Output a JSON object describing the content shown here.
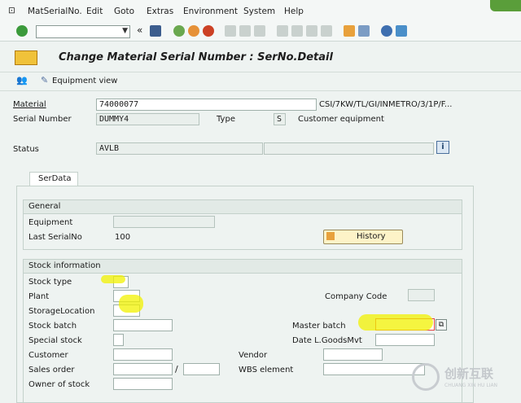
{
  "menu": {
    "items": [
      "MatSerialNo.",
      "Edit",
      "Goto",
      "Extras",
      "Environment",
      "System",
      "Help"
    ]
  },
  "toolbar": {
    "command_value": "",
    "back_symbol": "«"
  },
  "header": {
    "title": "Change Material Serial Number : SerNo.Detail"
  },
  "appbar": {
    "equipment_view": "Equipment view"
  },
  "form": {
    "material_label": "Material",
    "material_value": "74000077",
    "material_desc": "CSI/7KW/TL/GI/INMETRO/3/1P/F...",
    "serial_label": "Serial Number",
    "serial_value": "DUMMY4",
    "type_label": "Type",
    "type_value": "S",
    "type_desc": "Customer equipment",
    "status_label": "Status",
    "status_value": "AVLB",
    "status_value2": ""
  },
  "tabs": [
    {
      "label": "SerData"
    }
  ],
  "general": {
    "heading": "General",
    "equipment_label": "Equipment",
    "equipment_value": "",
    "last_serial_label": "Last SerialNo",
    "last_serial_value": "100",
    "history_button": "History"
  },
  "stock": {
    "heading": "Stock information",
    "stock_type_label": "Stock type",
    "plant_label": "Plant",
    "storage_location_label": "StorageLocation",
    "stock_batch_label": "Stock batch",
    "special_stock_label": "Special stock",
    "customer_label": "Customer",
    "sales_order_label": "Sales order",
    "sales_order_sep": "/",
    "owner_label": "Owner of stock",
    "company_code_label": "Company Code",
    "master_batch_label": "Master batch",
    "date_goods_label": "Date L.GoodsMvt",
    "vendor_label": "Vendor",
    "wbs_label": "WBS element"
  },
  "watermark": {
    "text": "创新互联",
    "subtext": "CHUANG XIN HU LIAN"
  },
  "colors": {
    "highlight": "#f2f200",
    "title_icon": "#f0c23a",
    "accent_green": "#5a9e3a"
  }
}
